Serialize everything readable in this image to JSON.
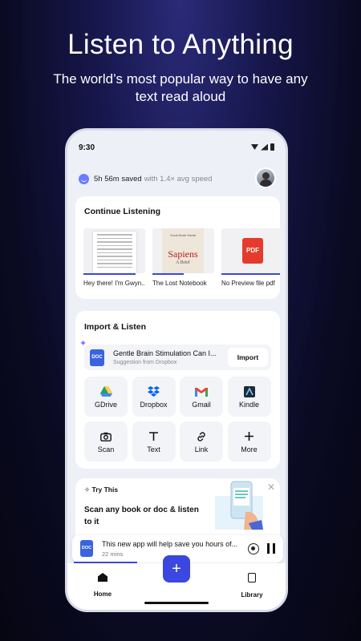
{
  "hero": {
    "title": "Listen to Anything",
    "subtitle": "The world’s most popular way to have any text read aloud"
  },
  "status_bar": {
    "time": "9:30"
  },
  "stats": {
    "saved": "5h 56m saved",
    "speed": "with 1.4× avg speed"
  },
  "continue_listening": {
    "title": "Continue Listening",
    "items": [
      {
        "label": "Hey there! I'm Gwyn...",
        "progress": 0.85
      },
      {
        "label": "The Lost Notebook",
        "progress": 0.5,
        "cover_author": "Yuval Noah Harari",
        "cover_title": "Sapiens",
        "cover_subtitle": "A Brief"
      },
      {
        "label": "No Preview file pdf",
        "progress": 0.95,
        "badge": "PDF"
      }
    ]
  },
  "import": {
    "title": "Import & Listen",
    "suggestion": {
      "title": "Gentle Brain Stimulation Can I...",
      "subtitle": "Suggestion from Dropbox",
      "badge": "DOC",
      "button": "Import"
    },
    "sources": [
      {
        "label": "GDrive",
        "icon": "gdrive-icon"
      },
      {
        "label": "Dropbox",
        "icon": "dropbox-icon"
      },
      {
        "label": "Gmail",
        "icon": "gmail-icon"
      },
      {
        "label": "Kindle",
        "icon": "kindle-icon"
      },
      {
        "label": "Scan",
        "icon": "camera-icon"
      },
      {
        "label": "Text",
        "icon": "text-icon"
      },
      {
        "label": "Link",
        "icon": "link-icon"
      },
      {
        "label": "More",
        "icon": "plus-icon"
      }
    ]
  },
  "try_this": {
    "header": "Try This",
    "text": "Scan any book or doc & listen to it"
  },
  "player": {
    "title": "This new app will help save you hours of...",
    "duration": "22 mins",
    "badge": "DOC",
    "progress": 0.3
  },
  "tabbar": {
    "home": "Home",
    "library": "Library"
  },
  "colors": {
    "accent": "#3a47e0",
    "pdf": "#e53b2c",
    "doc": "#3a63e0"
  }
}
